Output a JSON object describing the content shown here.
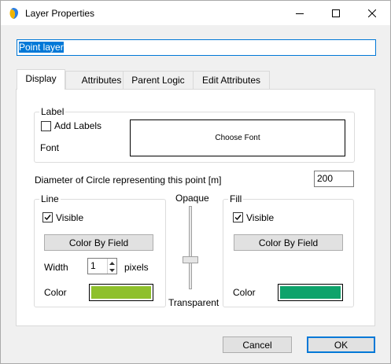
{
  "window": {
    "title": "Layer Properties",
    "icons": {
      "app": "app-logo-icon",
      "minimize": "minimize-icon",
      "maximize": "maximize-icon",
      "close": "close-icon"
    }
  },
  "layer_name": "Point layer",
  "tabs": [
    {
      "label": "Display",
      "active": true
    },
    {
      "label": "Attributes",
      "active": false
    },
    {
      "label": "Parent Logic",
      "active": false
    },
    {
      "label": "Edit Attributes",
      "active": false
    }
  ],
  "label_group": {
    "title": "Label",
    "add_labels": "Add Labels",
    "add_labels_checked": false,
    "font_label": "Font",
    "choose_font": "Choose Font"
  },
  "diameter": {
    "label": "Diameter of Circle representing this point [m]",
    "value": "200"
  },
  "line_group": {
    "title": "Line",
    "visible_label": "Visible",
    "visible_checked": true,
    "color_by_field": "Color By Field",
    "width_label": "Width",
    "width_value": "1",
    "pixels_label": "pixels",
    "color_label": "Color",
    "color": "#8ec02c"
  },
  "opacity": {
    "top_label": "Opaque",
    "bottom_label": "Transparent"
  },
  "fill_group": {
    "title": "Fill",
    "visible_label": "Visible",
    "visible_checked": true,
    "color_by_field": "Color By Field",
    "color_label": "Color",
    "color": "#0ea36b"
  },
  "footer": {
    "cancel": "Cancel",
    "ok": "OK"
  }
}
